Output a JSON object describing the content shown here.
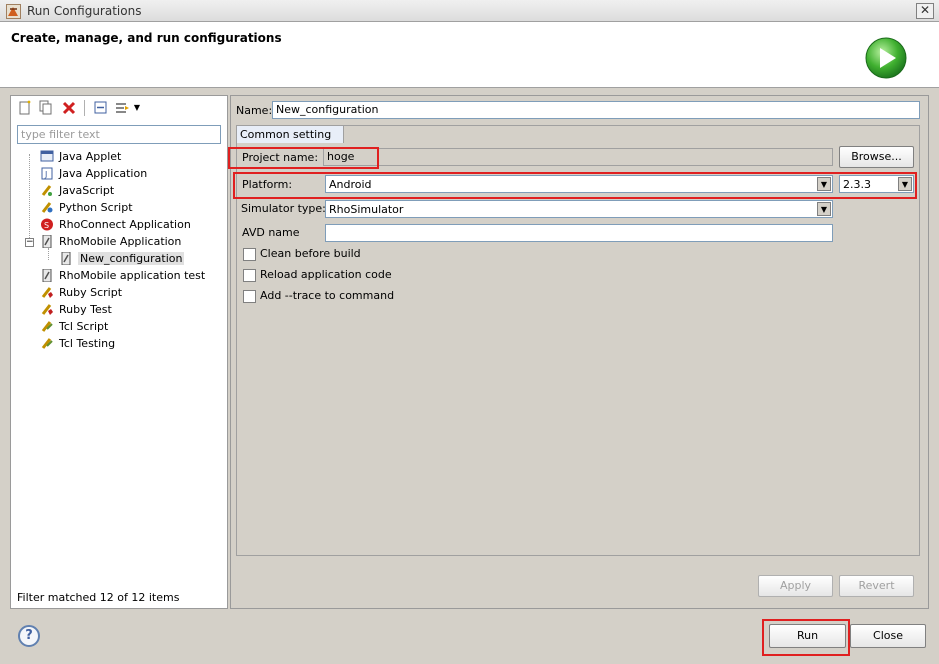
{
  "window": {
    "title": "Run Configurations",
    "close_glyph": "✕"
  },
  "header": {
    "title": "Create, manage, and run configurations",
    "icon": "run-icon",
    "accent_color": "#2ea02e"
  },
  "left": {
    "filter_placeholder": "type filter text",
    "filter_value": "",
    "toolbar": [
      "new-config-icon",
      "duplicate-icon",
      "delete-icon",
      "collapse-all-icon",
      "filter-icon",
      "dropdown-icon"
    ],
    "tree": [
      {
        "label": "Java Applet",
        "icon": "java-applet-icon"
      },
      {
        "label": "Java Application",
        "icon": "java-app-icon"
      },
      {
        "label": "JavaScript",
        "icon": "javascript-icon"
      },
      {
        "label": "Python Script",
        "icon": "python-icon"
      },
      {
        "label": "RhoConnect Application",
        "icon": "rhoconnect-icon"
      },
      {
        "label": "RhoMobile Application",
        "icon": "rhomobile-icon",
        "expanded": true
      },
      {
        "label": "New_configuration",
        "icon": "config-icon",
        "selected": true
      },
      {
        "label": "RhoMobile application test",
        "icon": "rhomobile-test-icon"
      },
      {
        "label": "Ruby Script",
        "icon": "ruby-icon"
      },
      {
        "label": "Ruby Test",
        "icon": "ruby-test-icon"
      },
      {
        "label": "Tcl Script",
        "icon": "tcl-icon"
      },
      {
        "label": "Tcl Testing",
        "icon": "tcl-test-icon"
      }
    ],
    "status": "Filter matched 12 of 12 items"
  },
  "right": {
    "name_label": "Name:",
    "name_value": "New_configuration",
    "tab": "Common setting",
    "project_label": "Project name:",
    "project_value": "hoge",
    "browse_label": "Browse...",
    "platform_label": "Platform:",
    "platform_value": "Android",
    "version_value": "2.3.3",
    "simulator_label": "Simulator type:",
    "simulator_value": "RhoSimulator",
    "avd_label": "AVD name",
    "avd_value": "",
    "checkboxes": [
      {
        "label": "Clean before build",
        "checked": false
      },
      {
        "label": "Reload application code",
        "checked": false
      },
      {
        "label": "Add --trace to command",
        "checked": false
      }
    ],
    "apply_label": "Apply",
    "revert_label": "Revert"
  },
  "footer": {
    "help_glyph": "?",
    "run_label": "Run",
    "close_label": "Close"
  },
  "highlight_color": "#e02020"
}
